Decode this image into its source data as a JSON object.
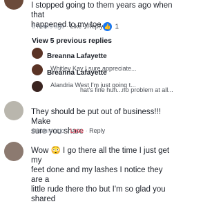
{
  "comment1": {
    "text_line1": "I stopped going to them years ago when that",
    "text_line2": "happened to my toe.",
    "time": "6 hours ago",
    "like": "Like",
    "reply": "Reply",
    "reaction_count": "1"
  },
  "view_previous": "View 5 previous replies",
  "replies": [
    {
      "name": "Breanna Lafayette",
      "snippet": "Whitley Kay I sure appreciate..."
    },
    {
      "name": "Breanna Lafayette",
      "snippet": "Alandria West I'm just going t..."
    },
    {
      "name": "",
      "snippet": "hat's fine hun...no problem at all..."
    }
  ],
  "comment2": {
    "text_line1": "They should be put out of business!!! Make",
    "text_line2": "sure you share",
    "time": "6 hours ago",
    "love": "Love",
    "reply": "Reply"
  },
  "comment3": {
    "text_line1": "Wow 😳 I go there all the time I just get my",
    "text_line2": "feet done and my lashes I notice they are a",
    "text_line3": "little rude there tho but I'm so glad you shared"
  },
  "colors": {
    "fb_blue": "#1877f2",
    "love_red": "#f33e58",
    "meta_gray": "#8d949e"
  }
}
